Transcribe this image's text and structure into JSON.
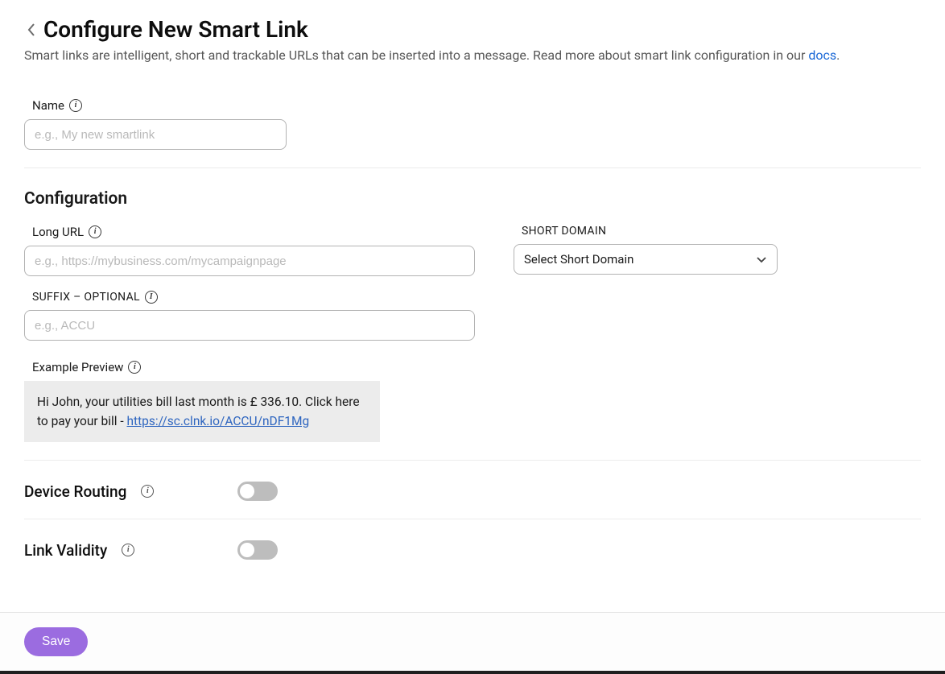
{
  "header": {
    "title": "Configure New Smart Link",
    "subtitle_prefix": "Smart links are intelligent, short and trackable URLs that can be inserted into a message. Read more about smart link configuration in our ",
    "docs_link_text": "docs",
    "subtitle_suffix": "."
  },
  "name_field": {
    "label": "Name",
    "placeholder": "e.g., My new smartlink",
    "value": ""
  },
  "configuration": {
    "section_title": "Configuration",
    "long_url": {
      "label": "Long URL",
      "placeholder": "e.g., https://mybusiness.com/mycampaignpage",
      "value": ""
    },
    "short_domain": {
      "label": "SHORT DOMAIN",
      "selected": "Select Short Domain"
    },
    "suffix": {
      "label": "SUFFIX – OPTIONAL",
      "placeholder": "e.g., ACCU",
      "value": ""
    },
    "example_preview": {
      "label": "Example Preview",
      "text_before_link": "Hi John, your utilities bill last month is £ 336.10. Click here to pay your bill - ",
      "link_text": "https://sc.clnk.io/ACCU/nDF1Mg"
    }
  },
  "device_routing": {
    "label": "Device Routing",
    "enabled": false
  },
  "link_validity": {
    "label": "Link Validity",
    "enabled": false
  },
  "footer": {
    "save_label": "Save"
  }
}
